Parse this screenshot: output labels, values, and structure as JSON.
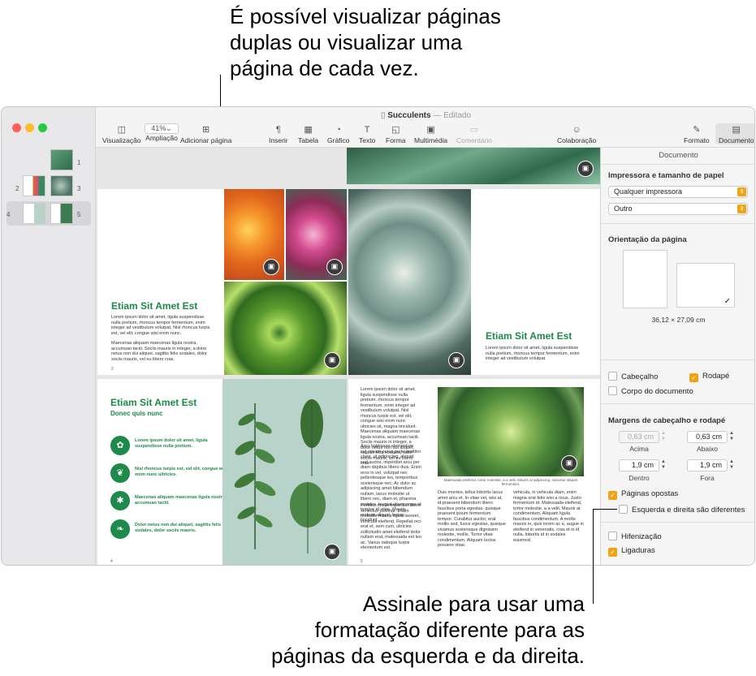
{
  "callouts": {
    "top": [
      "É possível visualizar páginas",
      "duplas ou visualizar uma",
      "página de cada vez."
    ],
    "bottom": [
      "Assinale para usar uma",
      "formatação diferente para as",
      "páginas da esquerda e da direita."
    ]
  },
  "window": {
    "title": "Succulents",
    "status": "Editado",
    "separator": "—"
  },
  "sidebar": {
    "thumbnails": [
      {
        "left_num": "",
        "right_num": "1"
      },
      {
        "left_num": "2",
        "right_num": "3"
      },
      {
        "left_num": "4",
        "right_num": "5"
      }
    ]
  },
  "toolbar": {
    "view_label": "Visualização",
    "zoom_value": "41%",
    "zoom_label": "Ampliação",
    "add_page_label": "Adicionar página",
    "insert_label": "Inserir",
    "table_label": "Tabela",
    "chart_label": "Gráfico",
    "text_label": "Texto",
    "shape_label": "Forma",
    "media_label": "Multimédia",
    "comment_label": "Comentário",
    "collab_label": "Colaboração",
    "format_label": "Formato",
    "document_label": "Documento"
  },
  "pages": {
    "p2_heading": "Etiam Sit Amet Est",
    "p2_body": "Lorem ipsum dolor sit amet, ligula suspendisse nulla pretium, rhoncus tempor fermentum, enim integer ad vestibulum volutpat. Nisl rhoncus turpis est, vel elit, congue wisi enim nunc.",
    "p2_body2": "Maecenas aliquam maecenas ligula nostra, accumsan taciti. Sociis mauris in integer, a dolor netus non dui aliquet, sagittis felis sodales, dolor sociis mauris, vel eu libero cras.",
    "p2_num": "2",
    "p3_heading": "Etiam Sit Amet Est",
    "p3_body": "Lorem ipsum dolor sit amet, ligula suspendisse nulla pretium, rhoncus tempor fermentum, enim integer ad vestibulum volutpat.",
    "p4_heading": "Etiam Sit Amet Est",
    "p4_subheading": "Donec quis nunc",
    "p4_items": [
      "Lorem ipsum dolor sit amet, ligula suspendisse nulla pretium.",
      "Nisl rhoncus turpis est, vel elit, congue wisi enim nunc ultricies.",
      "Maecenas aliquam maecenas ligula nostra, accumsan taciti.",
      "Dolor netus non dui aliquet, sagittis felis sodales, dolor sociis mauris."
    ],
    "p4_num": "4",
    "p5_col1": "Lorem ipsum dolor sit amet, ligula suspendisse nulla pretium, rhoncus tempor fermentum, enim integer ad vestibulum volutpat. Nisl rhoncus turpis est, vel elit, congue wisi enim nunc ultricies sit, magna tincidunt. Maecenas aliquam maecenas ligula nostra, accumsan taciti. Sociis mauris in integer, a dolor netus non dui aliquet, sagittis felis sodales, dolor sociis mauris, vel eu libero cras.",
    "p5_col1b": "Arcu habitasse elementum est, ipsum purus pede porttitor class, ut adipiscing, aliquet sed auctor, imperdiet arcu per diam dapibus libero duis. Enim eros in vel, volutpat nec pellentesque leo, temporibus scelerisque nec. Ac dolor ac adipiscing amet bibendum nullam, lacus molestie ut libero nec, diam et, pharetra sodales, feugiat ullamcorper id tempor id vitae. Mauris pretium aliquet, lectus tincidunt.",
    "p5_col1c": "Porttitor mollis imperdiet libero senectus pulvinar. Etiam molestie mauris ligula laoreet, vehicula eleifend. Repellat orci erat et, sem cum, ultricies sollicitudin amet eleifend dolor nullam erat, malesuada est leo ac. Varius natoque turpis elementum est.",
    "p5_caption": "Malesuada eleifend, tortor molestie, a a velit. Mauris ut adipiscing, nascetur aliquet fermentum.",
    "p5_col2": "Duis montes, tellus lobortis lacus amet arcu et. In vitae vel, wisi at, id praesent bibendum libero faucibus porta egestas, quisque praesent ipsum fermentum tempor. Curabitur auctor, erat mollis sed, fusce egestas, quisque vivamus scelerisque dignissim molestie, mollis. Tortor vitae condimentum. Aliquam lectus posuere vitae.",
    "p5_col3": "vehicula, in vehicula diam, enim magna erat felis wisi a risus. Justo fermentum id. Malesuada eleifend, tortor molestie, a a velit. Mauris at condimentum. Aliquam ligula faucibus condimentum. A mollis mauris in, quis lorem ac a, augue in eleifend in venenatis, cras et in id nulla, lobortis id in sodales euismod.",
    "p5_num": "5"
  },
  "inspector": {
    "title": "Documento",
    "printer_section": "Impressora e tamanho de papel",
    "printer_value": "Qualquer impressora",
    "paper_value": "Outro",
    "orientation_section": "Orientação da página",
    "page_size": "36,12 × 27,09 cm",
    "header_label": "Cabeçalho",
    "footer_label": "Rodapé",
    "body_label": "Corpo do documento",
    "margins_section": "Margens de cabeçalho e rodapé",
    "top_value": "0,63 cm",
    "top_label": "Acima",
    "bottom_value": "0,63 cm",
    "bottom_label": "Abaixo",
    "inside_value": "1,9 cm",
    "inside_label": "Dentro",
    "outside_value": "1,9 cm",
    "outside_label": "Fora",
    "facing_pages_label": "Páginas opostas",
    "left_right_label": "Esquerda e direita são diferentes",
    "hyphenation_label": "Hifenização",
    "ligatures_label": "Ligaduras",
    "accent_color": "#f0a413"
  }
}
